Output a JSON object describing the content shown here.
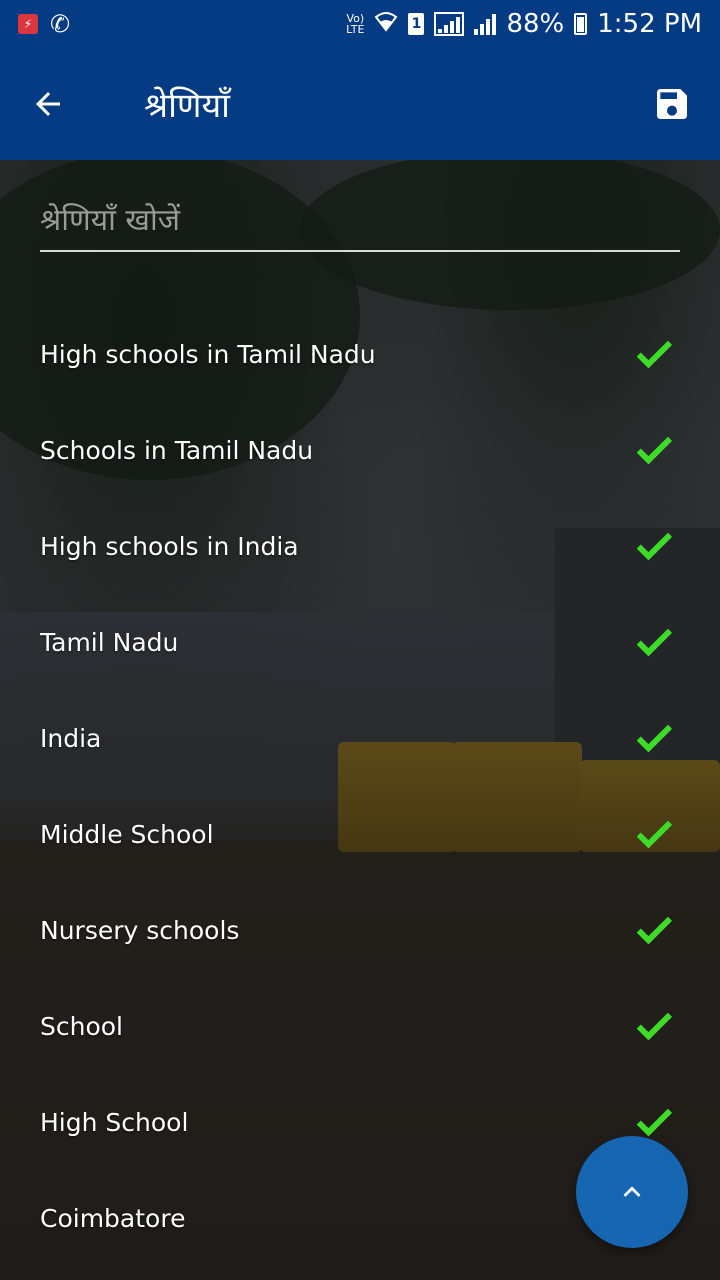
{
  "status_bar": {
    "network_label": "Vo) LTE",
    "sim_slot": "1",
    "battery": "88%",
    "time": "1:52 PM"
  },
  "app_bar": {
    "title": "श्रेणियाँ"
  },
  "search": {
    "placeholder": "श्रेणियाँ खोजें",
    "value": ""
  },
  "categories": [
    {
      "label": "High schools in Tamil Nadu",
      "checked": true
    },
    {
      "label": "Schools in Tamil Nadu",
      "checked": true
    },
    {
      "label": "High schools in India",
      "checked": true
    },
    {
      "label": "Tamil Nadu",
      "checked": true
    },
    {
      "label": "India",
      "checked": true
    },
    {
      "label": "Middle School",
      "checked": true
    },
    {
      "label": "Nursery schools",
      "checked": true
    },
    {
      "label": "School",
      "checked": true
    },
    {
      "label": "High School",
      "checked": true
    },
    {
      "label": "Coimbatore",
      "checked": true
    }
  ],
  "icons": {
    "back": "arrow-left-icon",
    "save": "floppy-disk-icon",
    "check": "check-icon",
    "scroll_up": "chevron-up-icon"
  },
  "colors": {
    "app_bar": "#053b82",
    "check": "#3ddc28",
    "fab": "#1565b0"
  }
}
